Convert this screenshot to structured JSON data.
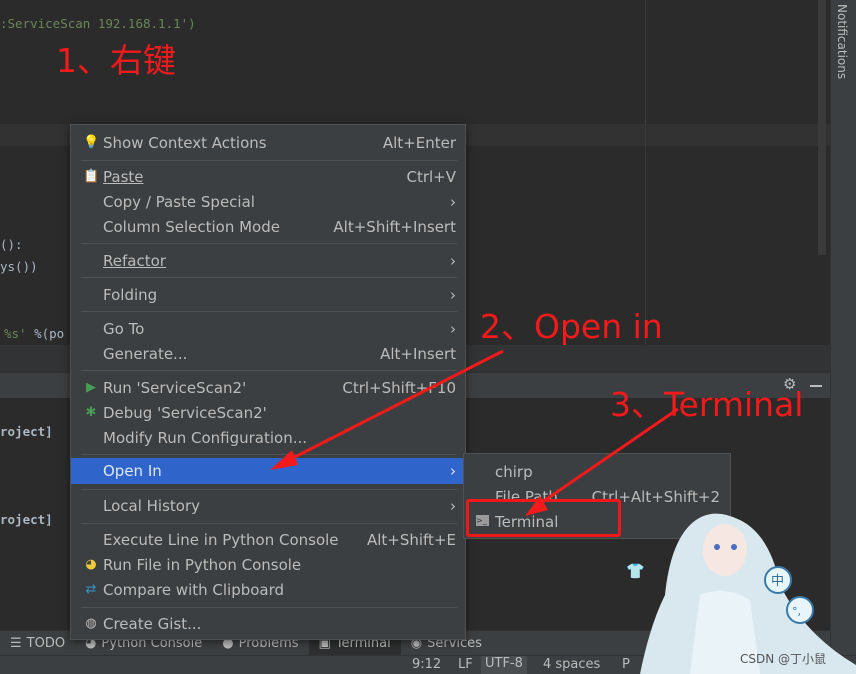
{
  "editor": {
    "line1": ":ServiceScan 192.168.1.1')",
    "line2": "():",
    "line3": "ys())",
    "line4_str": "%s'",
    "line4_rest": " %(po"
  },
  "tool_window": {
    "line1": "roject]",
    "line2": "roject]"
  },
  "right_panel": {
    "label": "Notifications"
  },
  "context_menu": {
    "items": [
      {
        "label": "Show Context Actions",
        "shortcut": "Alt+Enter",
        "icon": "lightbulb-icon"
      },
      {
        "label": "Paste",
        "shortcut": "Ctrl+V",
        "icon": "clipboard-icon"
      },
      {
        "label": "Copy / Paste Special",
        "shortcut": "",
        "submenu": true
      },
      {
        "label": "Column Selection Mode",
        "shortcut": "Alt+Shift+Insert"
      },
      {
        "label": "Refactor",
        "submenu": true
      },
      {
        "label": "Folding",
        "submenu": true
      },
      {
        "label": "Go To",
        "submenu": true
      },
      {
        "label": "Generate...",
        "shortcut": "Alt+Insert"
      },
      {
        "label": "Run 'ServiceScan2'",
        "shortcut": "Ctrl+Shift+F10",
        "icon": "run-icon"
      },
      {
        "label": "Debug 'ServiceScan2'",
        "icon": "debug-icon"
      },
      {
        "label": "Modify Run Configuration..."
      },
      {
        "label": "Open In",
        "submenu": true,
        "highlighted": true
      },
      {
        "label": "Local History",
        "submenu": true
      },
      {
        "label": "Execute Line in Python Console",
        "shortcut": "Alt+Shift+E"
      },
      {
        "label": "Run File in Python Console",
        "icon": "python-icon"
      },
      {
        "label": "Compare with Clipboard",
        "icon": "compare-icon"
      },
      {
        "label": "Create Gist...",
        "icon": "github-icon"
      }
    ]
  },
  "submenu": {
    "items": [
      {
        "label": "chirp"
      },
      {
        "label": "File Path",
        "shortcut": "Ctrl+Alt+Shift+2"
      },
      {
        "label": "Terminal",
        "icon": "terminal-icon"
      }
    ]
  },
  "bottom_tabs": [
    {
      "label": "TODO",
      "icon": "list-icon"
    },
    {
      "label": "Python Console",
      "icon": "python-icon"
    },
    {
      "label": "Problems",
      "icon": "problems-icon"
    },
    {
      "label": "Terminal",
      "icon": "terminal-icon",
      "active": true
    },
    {
      "label": "Services",
      "icon": "services-icon"
    }
  ],
  "status_bar": {
    "position": "9:12",
    "line_sep": "LF",
    "encoding": "UTF-8",
    "indent": "4 spaces",
    "interpreter": "P"
  },
  "annotations": {
    "step1": "1、右键",
    "step2": "2、Open in",
    "step3": "3、Terminal",
    "color": "#f21a1a"
  },
  "ime_badges": {
    "lang": "中",
    "punct": "°,"
  },
  "watermark": "CSDN @丁小鼠",
  "colors": {
    "highlight": "#2f65ca",
    "menu_bg": "#3c3f41",
    "editor_bg": "#2b2b2b"
  }
}
